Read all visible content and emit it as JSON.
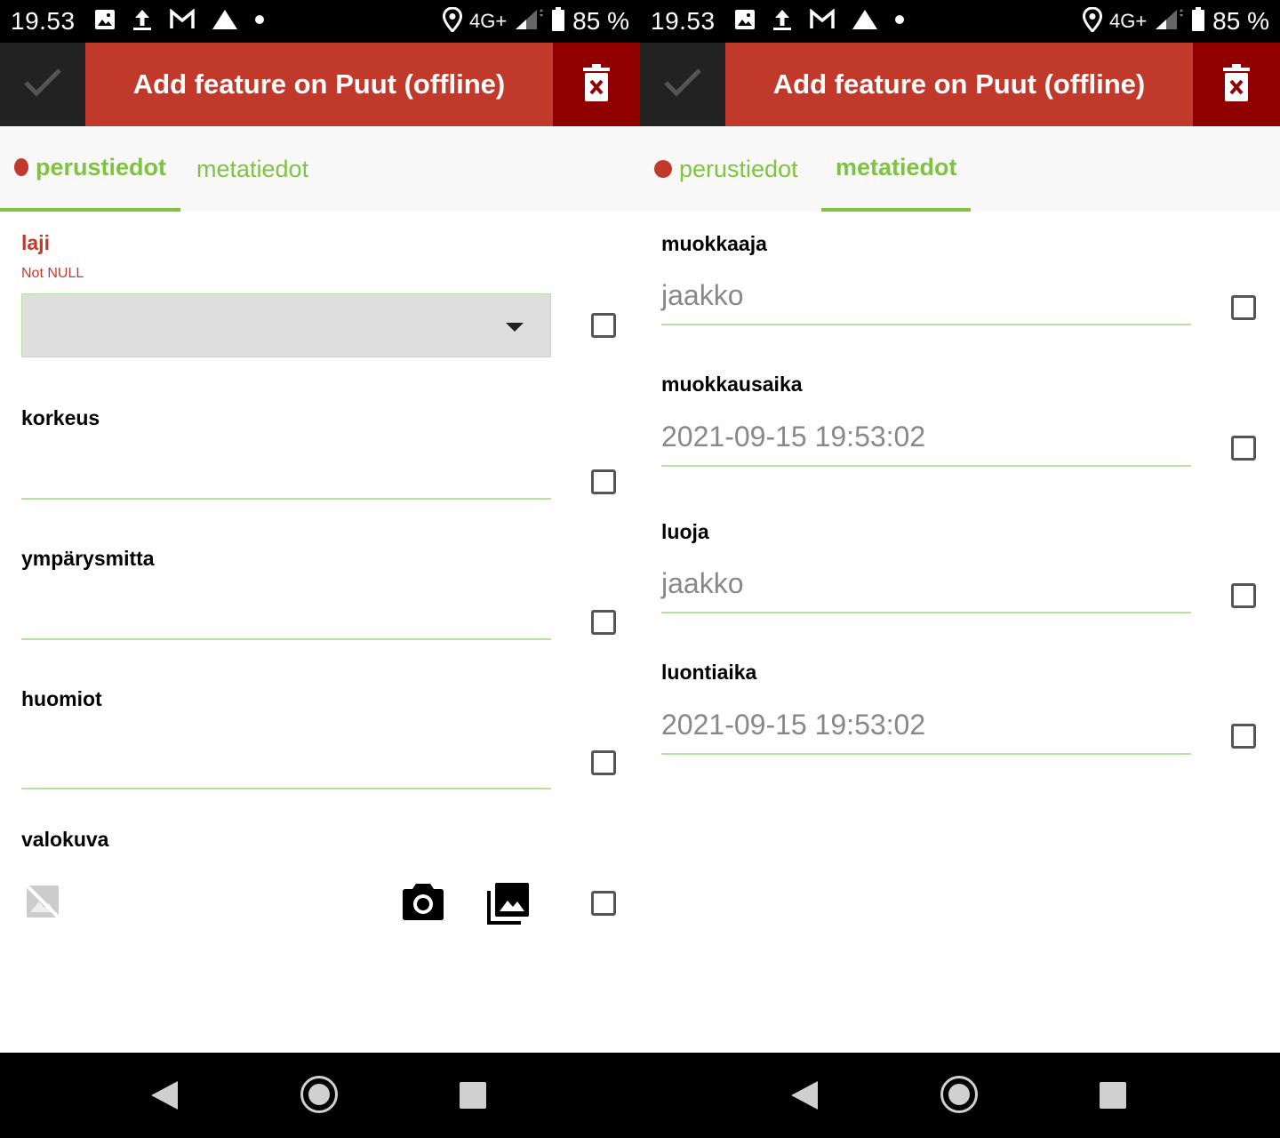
{
  "status_bar": {
    "time": "19.53",
    "network": "4G+",
    "battery": "85 %"
  },
  "toolbar": {
    "title": "Add feature on Puut (offline)"
  },
  "tabs": [
    {
      "label": "perustiedot"
    },
    {
      "label": "metatiedot"
    }
  ],
  "left_form": {
    "laji": {
      "label": "laji",
      "constraint": "Not NULL",
      "value": ""
    },
    "korkeus": {
      "label": "korkeus",
      "value": ""
    },
    "ymparysmitta": {
      "label": "ympärysmitta",
      "value": ""
    },
    "huomiot": {
      "label": "huomiot",
      "value": ""
    },
    "valokuva": {
      "label": "valokuva"
    }
  },
  "right_form": {
    "muokkaaja": {
      "label": "muokkaaja",
      "value": "jaakko"
    },
    "muokkausaika": {
      "label": "muokkausaika",
      "value": "2021-09-15 19:53:02"
    },
    "luoja": {
      "label": "luoja",
      "value": "jaakko"
    },
    "luontiaika": {
      "label": "luontiaika",
      "value": "2021-09-15 19:53:02"
    }
  },
  "colors": {
    "accent_red": "#c1392b",
    "accent_green": "#80c342",
    "dark_red": "#900000"
  },
  "icons": [
    "check-icon",
    "delete-icon",
    "camera-icon",
    "gallery-icon",
    "no-image-icon",
    "back-icon",
    "home-icon",
    "recents-icon"
  ]
}
